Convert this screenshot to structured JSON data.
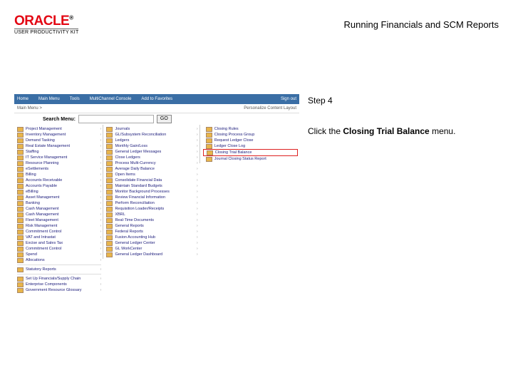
{
  "header": {
    "brand": "ORACLE",
    "brand_reg": "®",
    "brand_sub": "USER PRODUCTIVITY KIT",
    "title": "Running Financials and SCM Reports"
  },
  "instruction": {
    "step_label": "Step 4",
    "text_before": "Click the ",
    "text_bold": "Closing Trial Balance",
    "text_after": " menu."
  },
  "app": {
    "topbar": {
      "home": "Home",
      "menu": "Main Menu",
      "tools": "Tools",
      "mcc": "MultiChannel Console",
      "fav": "Add to Favorites",
      "signout": "Sign out"
    },
    "crumb": {
      "path": "Main Menu >",
      "personalize": "Personalize Content  Layout"
    },
    "search": {
      "label": "Search Menu:",
      "placeholder": "",
      "go": "GO"
    },
    "colA": [
      "Project Management",
      "Inventory Management",
      "Demand Tasking",
      "Real Estate Management",
      "Staffing",
      "IT Service Management",
      "Resource Planning",
      "eSettlements",
      "Billing",
      "Accounts Receivable",
      "Accounts Payable",
      "eBilling",
      "Asset Management",
      "Banking",
      "Cash Management",
      "Cash Management",
      "Fleet Management",
      "Risk Management",
      "Commitment Control",
      "VAT and Intrastat",
      "Excise and Sales Tax",
      "Commitment Control",
      "Spend",
      "Allocations",
      "Statutory Reports",
      "Set Up Financials/Supply Chain",
      "Enterprise Components",
      "Government Resource Glossary"
    ],
    "colB": [
      "Journals",
      "GL/Subsystem Reconciliation",
      "Ledgers",
      "Monthly Gain/Loss",
      "General Ledger Messages",
      "Close Ledgers",
      "Process Multi-Currency",
      "Average Daily Balance",
      "Open Items",
      "Consolidate Financial Data",
      "Maintain Standard Budgets",
      "Monitor Background Processes",
      "Review Financial Information",
      "Perform Reconciliation",
      "Requisition Loader/Receipts",
      "XBRL",
      "Real-Time Documents",
      "General Reports",
      "Federal Reports",
      "Fusion Accounting Hub",
      "General Ledger Center",
      "GL WorkCenter",
      "General Ledger Dashboard"
    ],
    "colC": [
      "Closing Rules",
      "Closing Process Group",
      "Request Ledger Close",
      "Ledger Close Log",
      "Closing Trial Balance",
      "Journal Closing Status Report"
    ]
  }
}
